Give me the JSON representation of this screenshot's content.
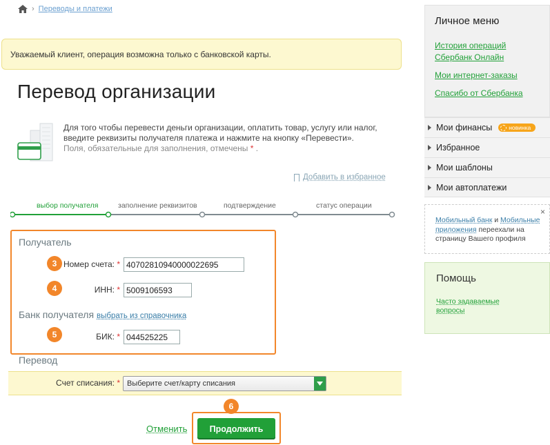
{
  "breadcrumb": {
    "link": "Переводы и платежи"
  },
  "notice": "Уважаемый клиент, операция возможна только с банковской карты.",
  "title": "Перевод организации",
  "intro": {
    "line1": "Для того чтобы перевести деньги организации, оплатить товар, услугу или налог,",
    "line2": "введите реквизиты получателя платежа и нажмите на кнопку «Перевести».",
    "required_note": "Поля, обязательные для заполнения, отмечены",
    "asterisk": "*"
  },
  "favorite": "Добавить в избранное",
  "steps": [
    {
      "label": "выбор получателя",
      "active": true
    },
    {
      "label": "заполнение реквизитов",
      "active": false
    },
    {
      "label": "подтверждение",
      "active": false
    },
    {
      "label": "статус операции",
      "active": false
    }
  ],
  "recipient": {
    "section": "Получатель",
    "account": {
      "label": "Номер счета:",
      "value": "40702810940000022695",
      "badge": "3"
    },
    "inn": {
      "label": "ИНН:",
      "value": "5009106593",
      "badge": "4"
    },
    "bank_section": "Банк получателя",
    "bank_link": "выбрать из справочника",
    "bik": {
      "label": "БИК:",
      "value": "044525225",
      "badge": "5"
    }
  },
  "transfer": {
    "section": "Перевод",
    "debit_label": "Счет списания:",
    "debit_placeholder": "Выберите счет/карту списания"
  },
  "actions": {
    "cancel": "Отменить",
    "continue": "Продолжить",
    "badge": "6"
  },
  "sidebar": {
    "personal_title": "Личное меню",
    "links": [
      "История операций Сбербанк Онлайн",
      "Мои интернет-заказы",
      "Спасибо от Сбербанка"
    ],
    "menu": [
      {
        "label": "Мои финансы",
        "badge": "новинка"
      },
      {
        "label": "Избранное"
      },
      {
        "label": "Мои шаблоны"
      },
      {
        "label": "Мои автоплатежи"
      }
    ],
    "tip": {
      "link1": "Мобильный банк",
      "and": "и",
      "link2": "Мобильные приложения",
      "text": "переехали на страницу Вашего профиля",
      "close": "×"
    },
    "help": {
      "title": "Помощь",
      "link": "Часто задаваемые вопросы"
    }
  },
  "colors": {
    "accent": "#21a038",
    "highlight": "#f2862a",
    "notice_bg": "#fdf8d0"
  }
}
